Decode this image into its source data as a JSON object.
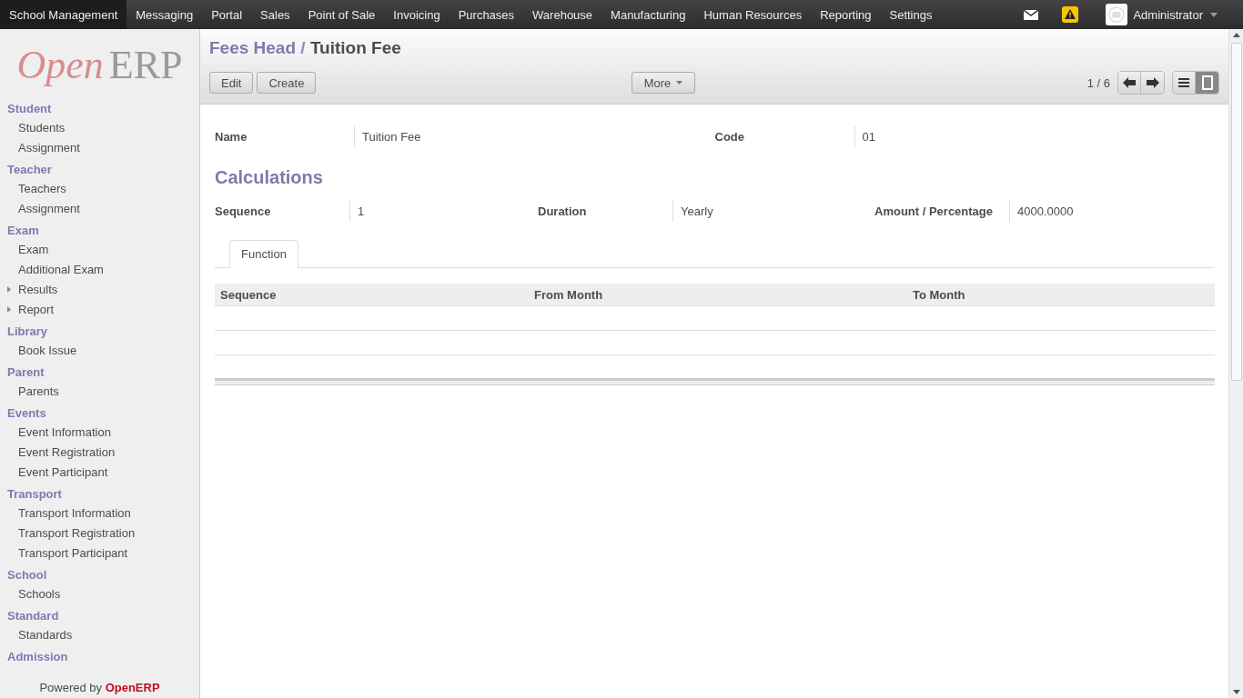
{
  "top_menu": [
    {
      "label": "School Management",
      "selected": true
    },
    {
      "label": "Messaging",
      "selected": false
    },
    {
      "label": "Portal",
      "selected": false
    },
    {
      "label": "Sales",
      "selected": false
    },
    {
      "label": "Point of Sale",
      "selected": false
    },
    {
      "label": "Invoicing",
      "selected": false
    },
    {
      "label": "Purchases",
      "selected": false
    },
    {
      "label": "Warehouse",
      "selected": false
    },
    {
      "label": "Manufacturing",
      "selected": false
    },
    {
      "label": "Human Resources",
      "selected": false
    },
    {
      "label": "Reporting",
      "selected": false
    },
    {
      "label": "Settings",
      "selected": false
    }
  ],
  "user": {
    "name": "Administrator"
  },
  "logo": {
    "part_1": "Open",
    "part_2": "ERP"
  },
  "sidebar": [
    {
      "heading": "Student",
      "items": [
        {
          "label": "Students",
          "expandable": false
        },
        {
          "label": "Assignment",
          "expandable": false
        }
      ]
    },
    {
      "heading": "Teacher",
      "items": [
        {
          "label": "Teachers",
          "expandable": false
        },
        {
          "label": "Assignment",
          "expandable": false
        }
      ]
    },
    {
      "heading": "Exam",
      "items": [
        {
          "label": "Exam",
          "expandable": false
        },
        {
          "label": "Additional Exam",
          "expandable": false
        },
        {
          "label": "Results",
          "expandable": true
        },
        {
          "label": "Report",
          "expandable": true
        }
      ]
    },
    {
      "heading": "Library",
      "items": [
        {
          "label": "Book Issue",
          "expandable": false
        }
      ]
    },
    {
      "heading": "Parent",
      "items": [
        {
          "label": "Parents",
          "expandable": false
        }
      ]
    },
    {
      "heading": "Events",
      "items": [
        {
          "label": "Event Information",
          "expandable": false
        },
        {
          "label": "Event Registration",
          "expandable": false
        },
        {
          "label": "Event Participant",
          "expandable": false
        }
      ]
    },
    {
      "heading": "Transport",
      "items": [
        {
          "label": "Transport Information",
          "expandable": false
        },
        {
          "label": "Transport Registration",
          "expandable": false
        },
        {
          "label": "Transport Participant",
          "expandable": false
        }
      ]
    },
    {
      "heading": "School",
      "items": [
        {
          "label": "Schools",
          "expandable": false
        }
      ]
    },
    {
      "heading": "Standard",
      "items": [
        {
          "label": "Standards",
          "expandable": false
        }
      ]
    },
    {
      "heading": "Admission"
    }
  ],
  "footer": {
    "prefix": "Powered by",
    "brand": "OpenERP"
  },
  "breadcrumb": {
    "parent": "Fees Head",
    "separator": "/",
    "current": "Tuition Fee"
  },
  "buttons": [
    "Edit",
    "Create"
  ],
  "more_button": "More",
  "pager": "1 / 6",
  "view_modes": [
    {
      "kind": "list",
      "selected": false
    },
    {
      "kind": "form",
      "selected": true
    }
  ],
  "form": {
    "top_fields": [
      {
        "label": "Name",
        "value": "Tuition Fee"
      },
      {
        "label": "Code",
        "value": "01"
      }
    ],
    "section_title": "Calculations",
    "calc_fields": [
      {
        "label": "Sequence",
        "value": "1"
      },
      {
        "label": "Duration",
        "value": "Yearly"
      },
      {
        "label": "Amount / Percentage",
        "value": "4000.0000"
      }
    ],
    "tabs": [
      {
        "label": "Function",
        "selected": true
      }
    ],
    "table": {
      "columns": [
        "Sequence",
        "From Month",
        "To Month"
      ]
    }
  }
}
